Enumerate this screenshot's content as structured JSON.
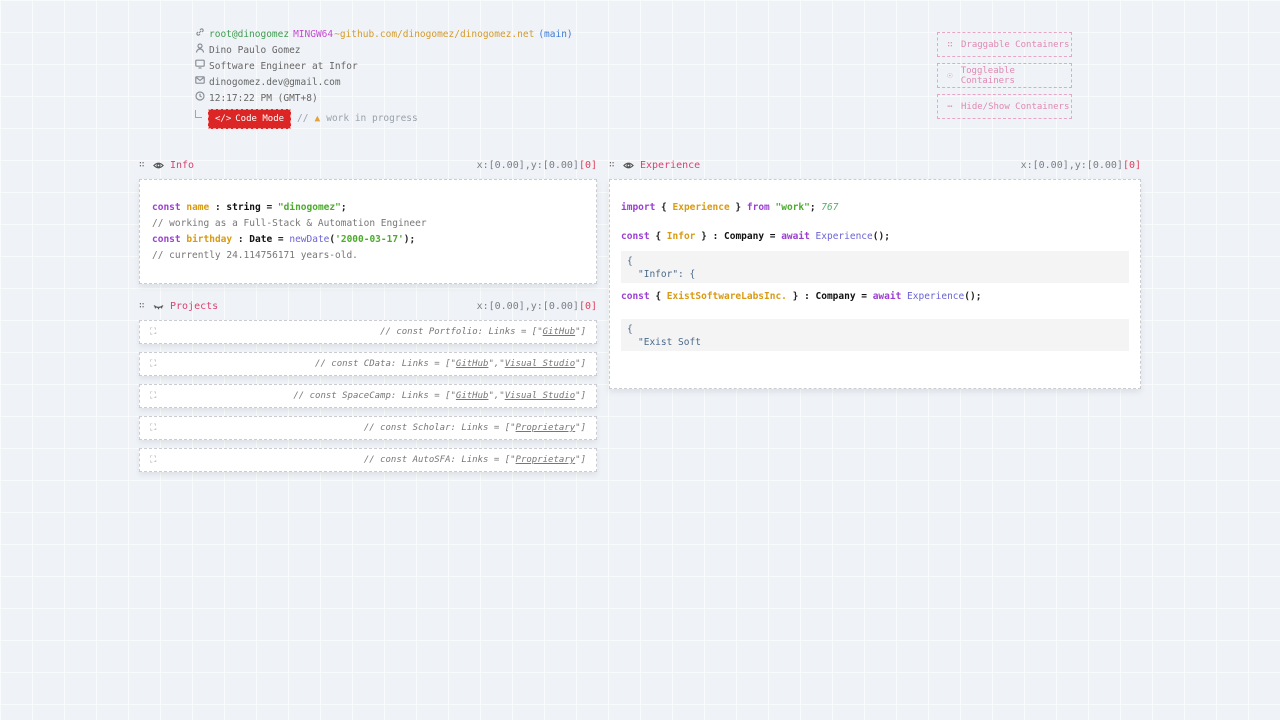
{
  "header": {
    "prompt_user": "root@dinogomez",
    "prompt_shell": "MINGW64",
    "prompt_path": "~github.com/dinogomez/dinogomez.net",
    "prompt_branch": "(main)",
    "name": "Dino Paulo Gomez",
    "role": "Software Engineer at Infor",
    "email": "dinogomez.dev@gmail.com",
    "time": "12:17:22 PM (GMT+8)",
    "code_mode_label": "Code Mode",
    "wip_prefix": "//",
    "wip_text": "work in progress"
  },
  "legend": {
    "items": [
      {
        "icon": "drag-handle-icon",
        "label": "Draggable Containers"
      },
      {
        "icon": "eye-icon",
        "label": "Toggleable Containers"
      },
      {
        "icon": "dots-icon",
        "label": "Hide/Show Containers"
      }
    ]
  },
  "panels": {
    "info": {
      "title": "Info",
      "coords": "x:[0.00],y:[0.00]",
      "index": "[0]",
      "code": {
        "l1_kw": "const",
        "l1_var": "name",
        "l1_sep": " : ",
        "l1_type": "string",
        "l1_eq": " = ",
        "l1_str": "\"dinogomez\"",
        "l1_end": ";",
        "l2_comment": "// working as a Full-Stack & Automation Engineer",
        "l3_kw": "const",
        "l3_var": "birthday",
        "l3_sep": " : ",
        "l3_type": "Date",
        "l3_eq": " = ",
        "l3_fn": "newDate",
        "l3_open": "(",
        "l3_str": "'2000-03-17'",
        "l3_end": ");",
        "l4_comment": "// currently 24.114756171  years-old."
      }
    },
    "projects": {
      "title": "Projects",
      "coords": "x:[0.00],y:[0.00]",
      "index": "[0]",
      "items": [
        {
          "prefix": "// const Portfolio: Links = [",
          "links": [
            "GitHub"
          ]
        },
        {
          "prefix": "// const CData: Links = [",
          "links": [
            "GitHub",
            "Visual Studio"
          ]
        },
        {
          "prefix": "// const SpaceCamp: Links = [",
          "links": [
            "GitHub",
            "Visual Studio"
          ]
        },
        {
          "prefix": "// const Scholar: Links = [",
          "links": [
            "Proprietary"
          ]
        },
        {
          "prefix": "// const AutoSFA: Links = [",
          "links": [
            "Proprietary"
          ]
        }
      ]
    },
    "experience": {
      "title": "Experience",
      "coords": "x:[0.00],y:[0.00]",
      "index": "[0]",
      "import_kw": "import",
      "import_open": " { ",
      "import_name": "Experience",
      "import_close": " } ",
      "from_kw": "from",
      "import_src": "\"work\"",
      "import_end": ";",
      "import_num": "767",
      "companies": [
        {
          "const_kw": "const",
          "name": "Infor",
          "type_part": " : Company = ",
          "await_kw": "await",
          "fn": "Experience",
          "end": "();",
          "json_open": "{",
          "json_line": "\"Infor\": {"
        },
        {
          "const_kw": "const",
          "name": "ExistSoftwareLabsInc.",
          "type_part": " : Company = ",
          "await_kw": "await",
          "fn": "Experience",
          "end": "();",
          "json_open": "{",
          "json_line": "\"Exist Soft"
        }
      ]
    }
  },
  "colors": {
    "accent_red": "#dc2626",
    "title_pink": "#d9416f",
    "background": "#eff3f7"
  }
}
